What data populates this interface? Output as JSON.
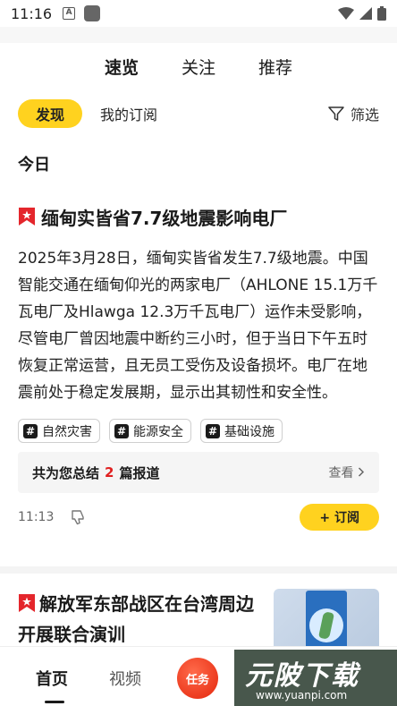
{
  "status": {
    "time": "11:16",
    "a_icon": "A"
  },
  "top_tabs": [
    "速览",
    "关注",
    "推荐"
  ],
  "filter": {
    "pill": "发现",
    "subscription": "我的订阅",
    "filter_label": "筛选"
  },
  "section_title": "今日",
  "article": {
    "headline": "缅甸实皆省7.7级地震影响电厂",
    "body": "2025年3月28日，缅甸实皆省发生7.7级地震。中国智能交通在缅甸仰光的两家电厂（AHLONE 15.1万千瓦电厂及Hlawga 12.3万千瓦电厂）运作未受影响，尽管电厂曾因地震中断约三小时，但于当日下午五时恢复正常运营，且无员工受伤及设备损坏。电厂在地震前处于稳定发展期，显示出其韧性和安全性。",
    "tags": [
      "自然灾害",
      "能源安全",
      "基础设施"
    ],
    "summary_prefix": "共为您总结",
    "summary_count": "2",
    "summary_suffix": "篇报道",
    "view": "查看",
    "time": "11:13",
    "follow": "+ 订阅"
  },
  "article2": {
    "headline": "解放军东部战区在台湾周边开展联合演训"
  },
  "bottom_nav": {
    "home": "首页",
    "video": "视频",
    "task": "任务"
  },
  "watermark": {
    "title": "元陂下载",
    "url": "www.yuanpi.com"
  },
  "colors": {
    "accent": "#ffd21f",
    "count_red": "#e02020",
    "flag_red": "#e4262c"
  }
}
